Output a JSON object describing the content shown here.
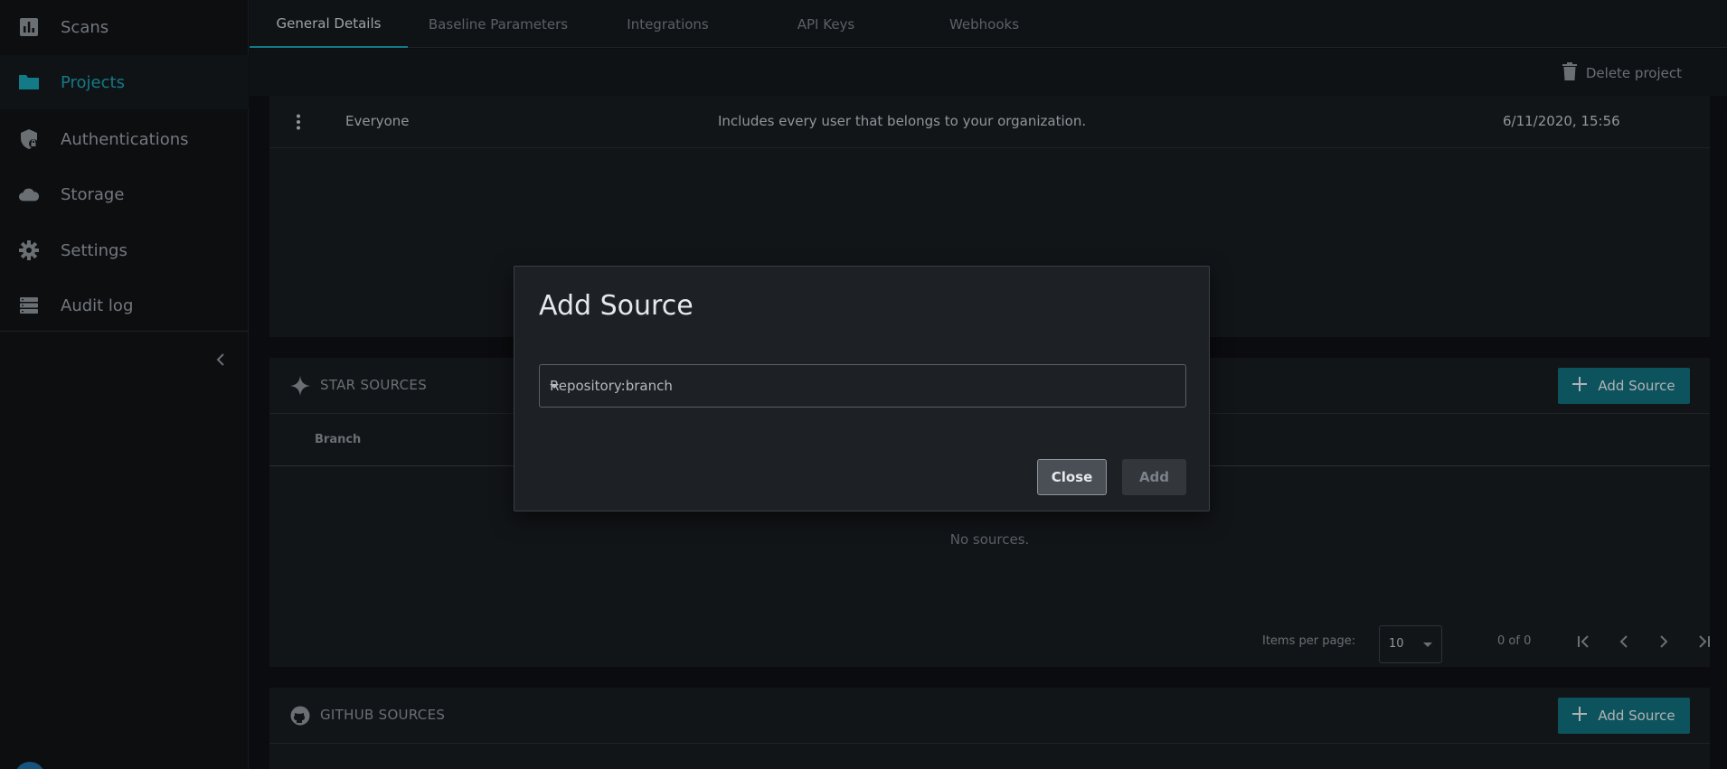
{
  "sidebar": {
    "items": [
      {
        "label": "Scans",
        "icon": "bar-chart-icon"
      },
      {
        "label": "Projects",
        "icon": "folder-icon",
        "active": true
      },
      {
        "label": "Authentications",
        "icon": "shield-lock-icon"
      },
      {
        "label": "Storage",
        "icon": "cloud-icon"
      },
      {
        "label": "Settings",
        "icon": "gear-icon"
      },
      {
        "label": "Audit log",
        "icon": "list-icon"
      }
    ],
    "collapse_icon": "chevron-left-icon"
  },
  "tabs": [
    {
      "label": "General Details",
      "active": true
    },
    {
      "label": "Baseline Parameters"
    },
    {
      "label": "Integrations"
    },
    {
      "label": "API Keys"
    },
    {
      "label": "Webhooks"
    }
  ],
  "toolbar": {
    "delete_label": "Delete project"
  },
  "users_table": {
    "rows": [
      {
        "name": "Everyone",
        "description": "Includes every user that belongs to your organization.",
        "date": "6/11/2020, 15:56"
      }
    ]
  },
  "star_sources": {
    "title": "STAR SOURCES",
    "add_label": "Add Source",
    "column": "Branch",
    "empty_text": "No sources.",
    "pager": {
      "items_per_page_label": "Items per page:",
      "items_per_page": "10",
      "range": "0 of 0"
    }
  },
  "github_sources": {
    "title": "GITHUB SOURCES",
    "add_label": "Add Source"
  },
  "dialog": {
    "title": "Add Source",
    "select_value": "Repository:branch",
    "close_label": "Close",
    "add_label": "Add"
  },
  "colors": {
    "accent": "#1aa3b5",
    "button": "#126f7c",
    "background": "#0f1114"
  }
}
